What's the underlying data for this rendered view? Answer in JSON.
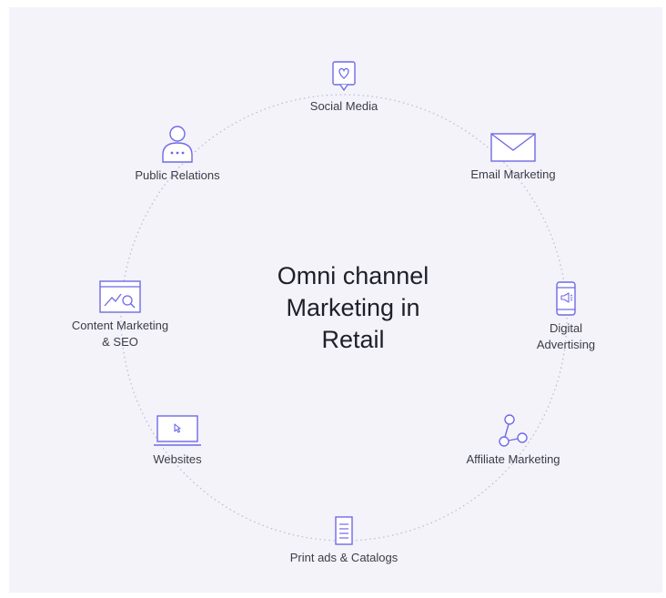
{
  "colors": {
    "background": "#f3f3f9",
    "accent": "#6f6ae8",
    "ring": "#b9b9dc",
    "title_text": "#1f1f2b",
    "label_text": "#3c3c4a"
  },
  "center": {
    "title_lines": [
      "Omni channel",
      "Marketing in",
      "Retail"
    ]
  },
  "nodes": [
    {
      "key": "social_media",
      "icon": "chat-heart-icon",
      "label_lines": [
        "Social Media"
      ]
    },
    {
      "key": "email_marketing",
      "icon": "envelope-icon",
      "label_lines": [
        "Email Marketing"
      ]
    },
    {
      "key": "digital_advertising",
      "icon": "phone-megaphone-icon",
      "label_lines": [
        "Digital",
        "Advertising"
      ]
    },
    {
      "key": "affiliate_marketing",
      "icon": "network-nodes-icon",
      "label_lines": [
        "Affiliate Marketing"
      ]
    },
    {
      "key": "print_ads",
      "icon": "document-icon",
      "label_lines": [
        "Print ads & Catalogs"
      ]
    },
    {
      "key": "websites",
      "icon": "laptop-cursor-icon",
      "label_lines": [
        "Websites"
      ]
    },
    {
      "key": "content_marketing",
      "icon": "chart-search-icon",
      "label_lines": [
        "Content Marketing",
        "& SEO"
      ]
    },
    {
      "key": "public_relations",
      "icon": "user-chat-icon",
      "label_lines": [
        "Public Relations"
      ]
    }
  ]
}
